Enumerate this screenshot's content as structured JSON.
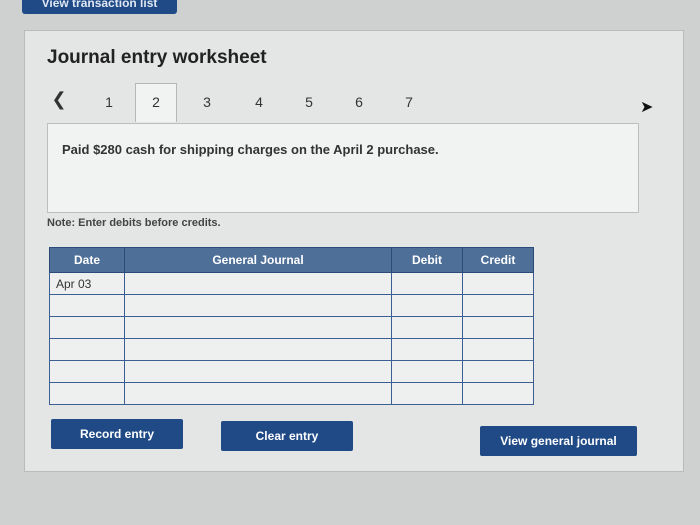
{
  "top_button": {
    "label": "View transaction list"
  },
  "worksheet": {
    "title": "Journal entry worksheet",
    "tabs": [
      "1",
      "2",
      "3",
      "4",
      "5",
      "6",
      "7"
    ],
    "active_tab": "2",
    "prev_icon": "chevron-left-icon",
    "description": "Paid $280 cash for shipping charges on the April 2 purchase.",
    "note": "Note: Enter debits before credits."
  },
  "journal": {
    "headers": {
      "date": "Date",
      "general_journal": "General Journal",
      "debit": "Debit",
      "credit": "Credit"
    },
    "rows": [
      {
        "date": "Apr 03",
        "account": "",
        "debit": "",
        "credit": ""
      },
      {
        "date": "",
        "account": "",
        "debit": "",
        "credit": ""
      },
      {
        "date": "",
        "account": "",
        "debit": "",
        "credit": ""
      },
      {
        "date": "",
        "account": "",
        "debit": "",
        "credit": ""
      },
      {
        "date": "",
        "account": "",
        "debit": "",
        "credit": ""
      },
      {
        "date": "",
        "account": "",
        "debit": "",
        "credit": ""
      }
    ]
  },
  "buttons": {
    "record": "Record entry",
    "clear": "Clear entry",
    "view_journal": "View general journal"
  },
  "colors": {
    "button_blue": "#1f4a86",
    "header_blue": "#4e6f98"
  }
}
